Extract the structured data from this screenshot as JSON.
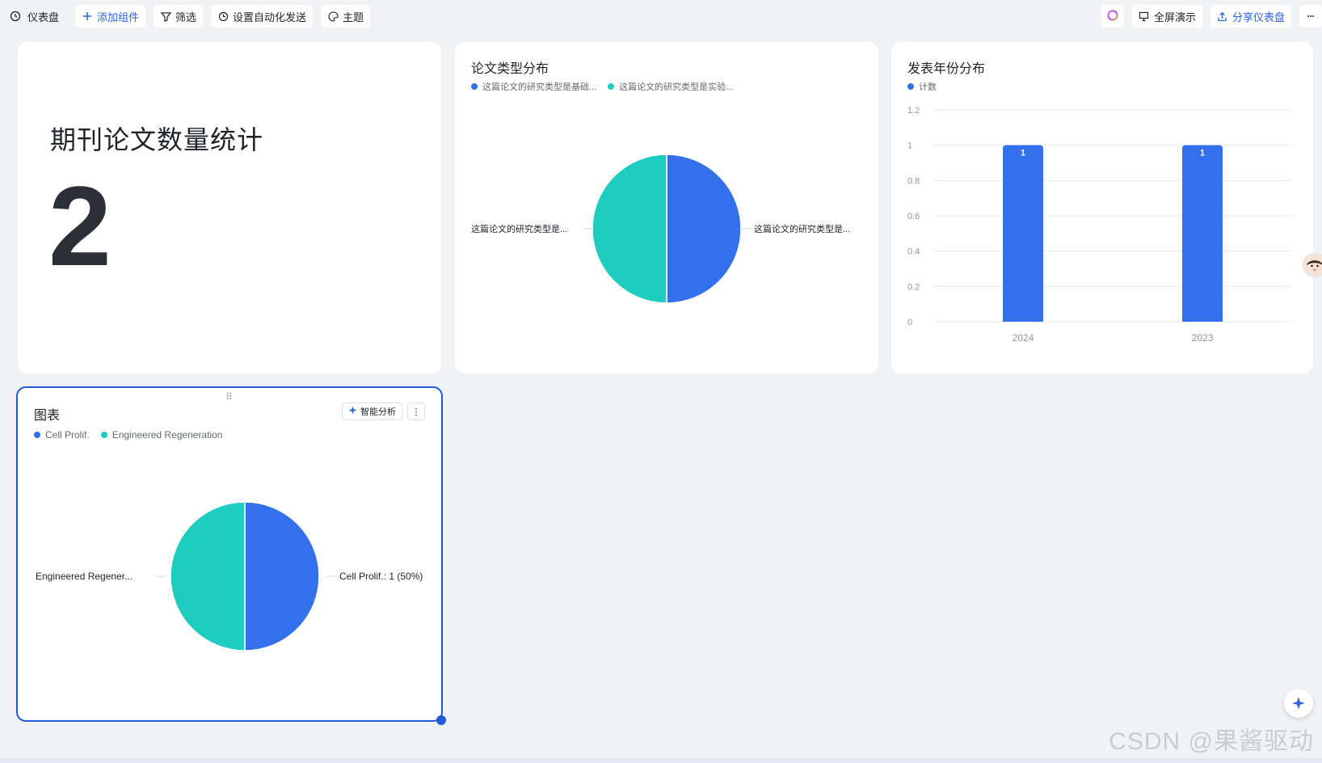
{
  "toolbar": {
    "title": "仪表盘",
    "add_widget": "添加组件",
    "filter": "筛选",
    "auto_send": "设置自动化发送",
    "theme": "主题",
    "fullscreen": "全屏演示",
    "share": "分享仪表盘",
    "more": "···"
  },
  "stat_card": {
    "title": "期刊论文数量统计",
    "value": "2"
  },
  "pie_card_1": {
    "title": "论文类型分布",
    "legend": [
      "这篇论文的研究类型是基础...",
      "这篇论文的研究类型是实验..."
    ],
    "label_left": "这篇论文的研究类型是...",
    "label_right": "这篇论文的研究类型是..."
  },
  "bar_card": {
    "title": "发表年份分布",
    "legend": [
      "计数"
    ]
  },
  "pie_card_2": {
    "title": "图表",
    "ai_button": "智能分析",
    "more": "⋮",
    "legend": [
      "Cell Prolif.",
      "Engineered Regeneration"
    ],
    "label_left": "Engineered Regener...",
    "label_right": "Cell Prolif.: 1 (50%)"
  },
  "colors": {
    "blue": "#3370eb",
    "teal": "#1ecdbf",
    "accent": "#2b63d9"
  },
  "chart_data": [
    {
      "type": "pie",
      "title": "论文类型分布",
      "categories": [
        "这篇论文的研究类型是基础...",
        "这篇论文的研究类型是实验..."
      ],
      "values": [
        1,
        1
      ]
    },
    {
      "type": "bar",
      "title": "发表年份分布",
      "categories": [
        "2024",
        "2023"
      ],
      "series": [
        {
          "name": "计数",
          "values": [
            1,
            1
          ]
        }
      ],
      "ylim": [
        0,
        1.2
      ],
      "yticks": [
        "0",
        "0.2",
        "0.4",
        "0.6",
        "0.8",
        "1",
        "1.2"
      ],
      "data_labels": [
        "1",
        "1"
      ],
      "grid": true
    },
    {
      "type": "pie",
      "title": "图表",
      "categories": [
        "Cell Prolif.",
        "Engineered Regeneration"
      ],
      "values": [
        1,
        1
      ]
    }
  ],
  "watermark": "CSDN @果酱驱动"
}
